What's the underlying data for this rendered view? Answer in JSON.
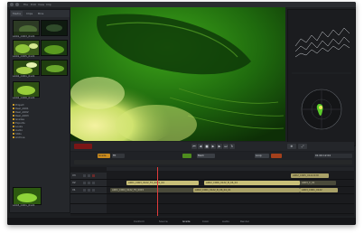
{
  "app": {
    "menu": [
      "File",
      "Edit",
      "View",
      "Clip",
      "Timeline",
      "Color",
      "Render",
      "Help"
    ]
  },
  "browser": {
    "tabs": [
      "Media",
      "Clips",
      "Bins"
    ],
    "thumbnails": [
      {
        "label": "A001_C003_0122"
      },
      {
        "label": "A001_C004_0122"
      },
      {
        "label": "A001_C005_0122"
      },
      {
        "label": "A002_C001_0122"
      },
      {
        "label": "A002_C002_0122"
      },
      {
        "label": "A002_C006_0122"
      },
      {
        "label": "A003_C001_0122"
      }
    ],
    "tree": [
      "Project",
      "Reel_A001",
      "Reel_A002",
      "Reel_A003",
      "Grades",
      "Exports",
      "Looks",
      "Audio",
      "Stills",
      "Archive"
    ]
  },
  "viewer": {
    "timecode": "01:00:12:04"
  },
  "transport": {
    "labels": [
      "Grade",
      "Fit",
      "Mark",
      "Loop"
    ]
  },
  "timeline": {
    "tracks": [
      {
        "name": "V3",
        "clips": [
          {
            "label": "A002_C005_0122.R3D",
            "style": "gold"
          }
        ]
      },
      {
        "name": "V2",
        "clips": [
          {
            "label": "A001_C003_0122_FX_0015_04",
            "style": "khaki"
          },
          {
            "label": "A002_C006_0122_B_06_04",
            "style": "khaki"
          },
          {
            "label": "A003_C_01",
            "style": "dark"
          }
        ]
      },
      {
        "name": "V1",
        "clips": [
          {
            "label": "A001_C004_0122_FX_0015",
            "style": "dark"
          },
          {
            "label": "A002_C001_0122_B_06_04_01",
            "style": "gold"
          },
          {
            "label": "A003_C001_0122",
            "style": "gold"
          }
        ]
      }
    ]
  },
  "status": [
    "Conform",
    "Source",
    "Grade",
    "Color",
    "Audio",
    "Render"
  ]
}
